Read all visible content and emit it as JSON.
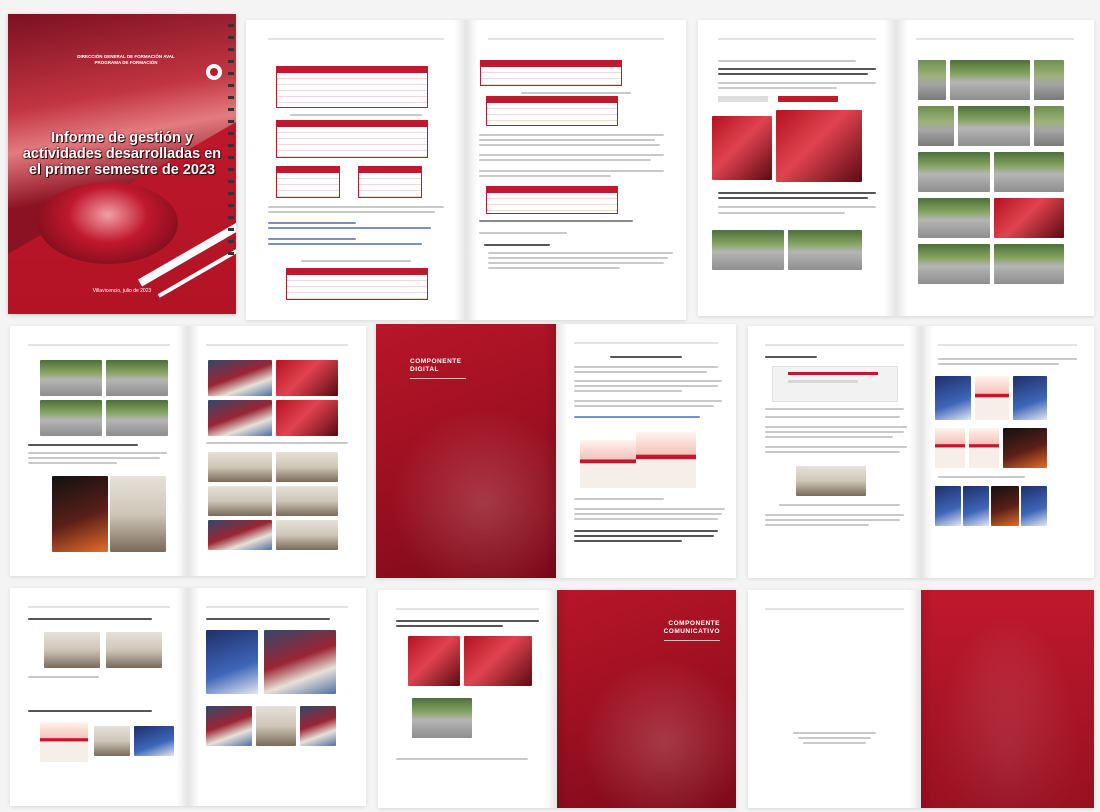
{
  "cover": {
    "institution_lines": [
      "DIRECCIÓN GENERAL DE FORMACIÓN AVAL",
      "PROGRAMA DE FORMACIÓN"
    ],
    "title": "Informe de gestión y actividades desarrolladas en el primer semestre de 2023",
    "date": "Villavicencio, julio de 2023"
  },
  "sections": {
    "digital": [
      "COMPONENTE",
      "DIGITAL"
    ],
    "comunicativo": [
      "COMPONENTE",
      "COMUNICATIVO"
    ]
  },
  "colors": {
    "accent": "#c0182d",
    "paper": "#ffffff",
    "background": "#f4f4f4"
  }
}
